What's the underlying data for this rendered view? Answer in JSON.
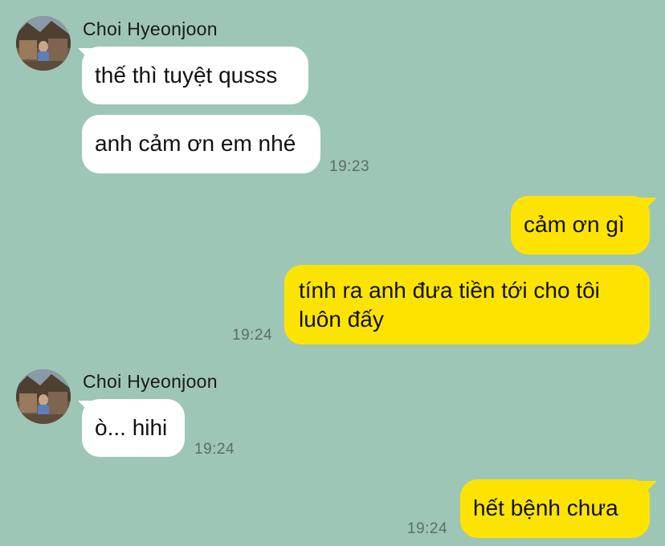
{
  "colors": {
    "background": "#9dc6b6",
    "incoming_bubble": "#ffffff",
    "outgoing_bubble": "#fde400",
    "timestamp": "#5d6e68"
  },
  "groups": [
    {
      "direction": "incoming",
      "sender": "Choi Hyeonjoon",
      "avatar_icon": "profile-photo-icon",
      "messages": [
        {
          "text": "thế thì tuyệt qusss"
        },
        {
          "text": "anh cảm ơn em nhé",
          "time": "19:23"
        }
      ]
    },
    {
      "direction": "outgoing",
      "messages": [
        {
          "text": "cảm ơn gì"
        },
        {
          "text": "tính ra anh đưa tiền tới cho tôi luôn đấy",
          "time": "19:24"
        }
      ]
    },
    {
      "direction": "incoming",
      "sender": "Choi Hyeonjoon",
      "avatar_icon": "profile-photo-icon",
      "messages": [
        {
          "text": "ò... hihi",
          "time": "19:24"
        }
      ]
    },
    {
      "direction": "outgoing",
      "messages": [
        {
          "text": "hết bệnh chưa",
          "time": "19:24"
        }
      ]
    }
  ]
}
